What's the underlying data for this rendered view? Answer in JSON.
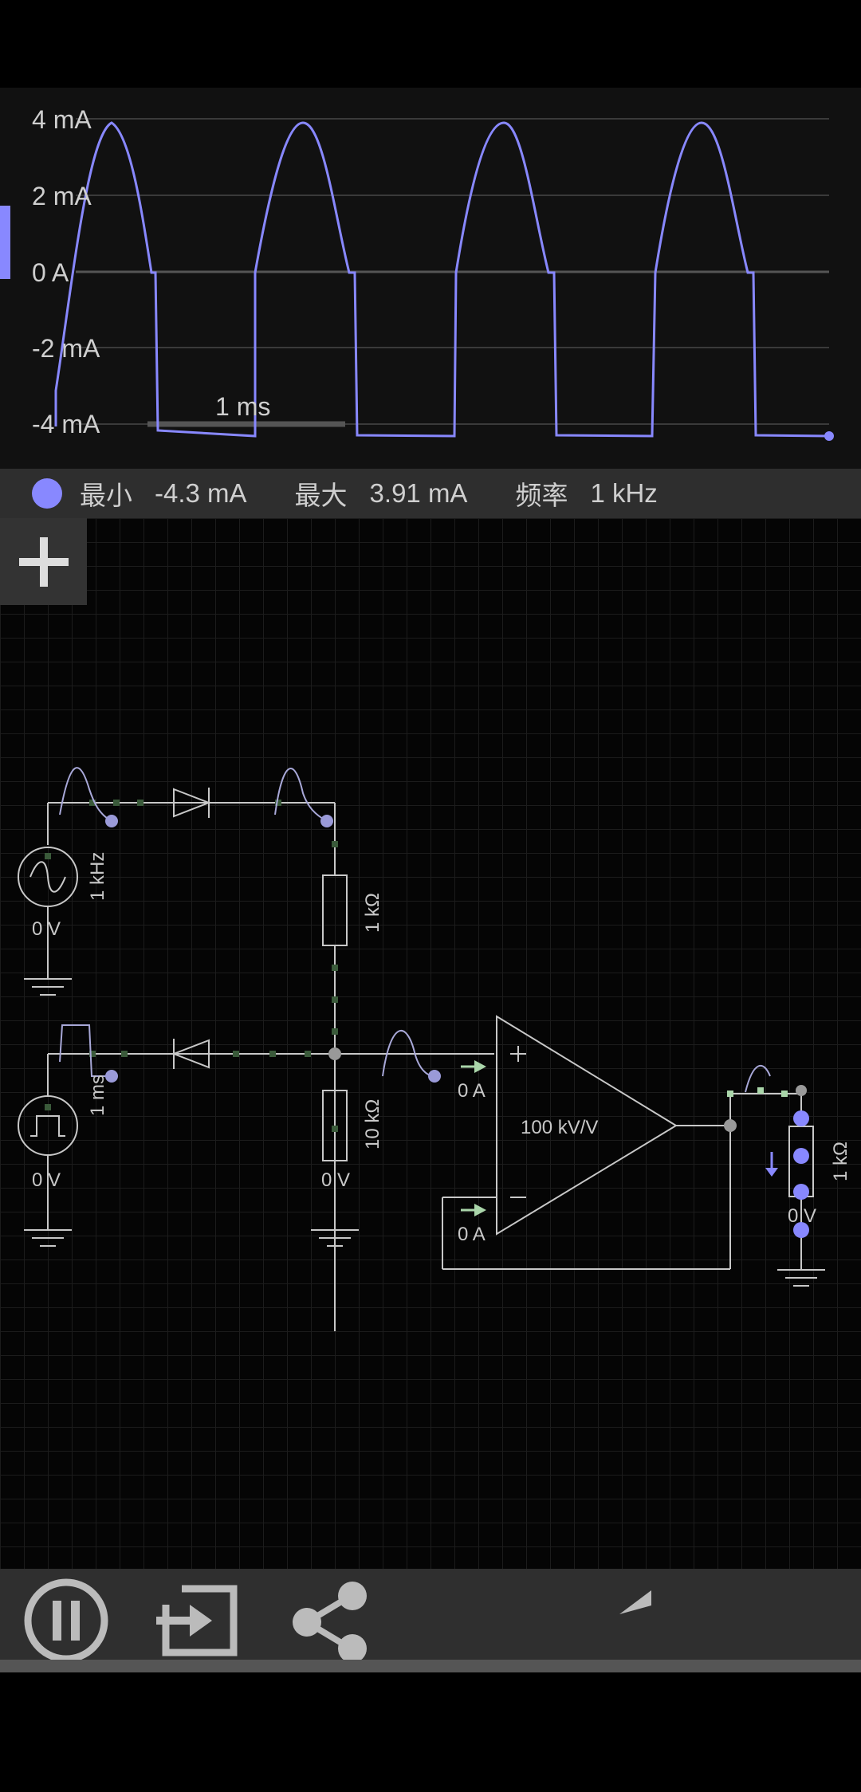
{
  "scope": {
    "y_axis_labels": [
      "4 mA",
      "2 mA",
      "0 A",
      "-2 mA",
      "-4 mA"
    ],
    "timescale_label": "1 ms",
    "trace_color": "#8888ff"
  },
  "legend": {
    "min_label": "最小",
    "min_value": "-4.3 mA",
    "max_label": "最大",
    "max_value": "3.91 mA",
    "freq_label": "频率",
    "freq_value": "1 kHz"
  },
  "circuit": {
    "ac_source_freq": "1 kHz",
    "ac_source_voltage": "0 V",
    "pulse_source_width": "1 ms",
    "pulse_source_voltage": "0 V",
    "resistor_top": "1 kΩ",
    "resistor_bottom": "10 kΩ",
    "resistor_bottom_voltage": "0 V",
    "opamp_gain": "100 kV/V",
    "opamp_plus_current": "0 A",
    "opamp_minus_current": "0 A",
    "resistor_out": "1 kΩ",
    "resistor_out_voltage": "0 V",
    "accent": "#8888ff",
    "wire_color": "#c8c8c8"
  },
  "toolbar": {
    "icons": [
      "pause-icon",
      "import-icon",
      "share-icon",
      "undo-icon"
    ]
  }
}
